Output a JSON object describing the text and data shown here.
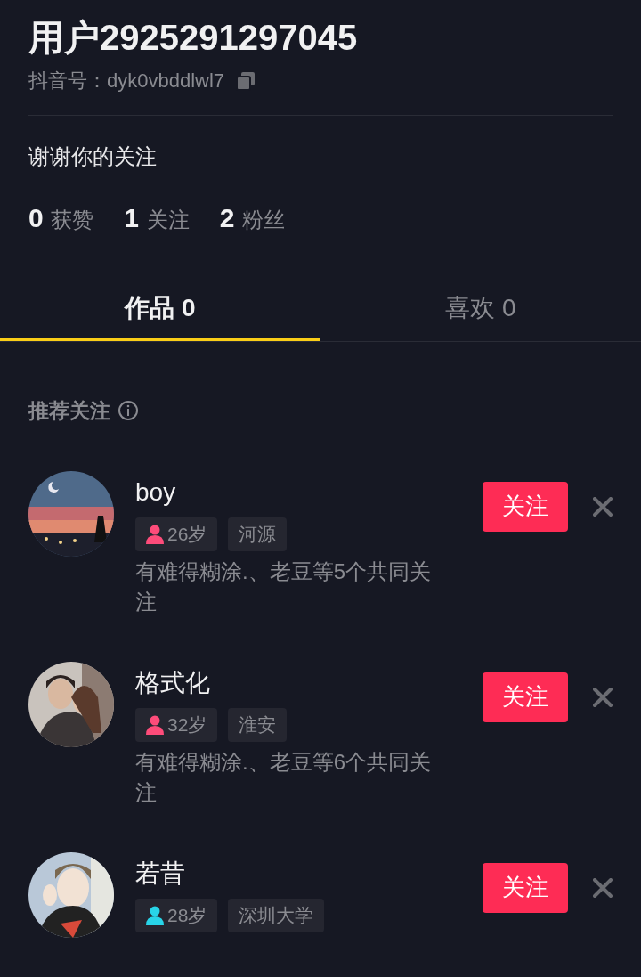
{
  "profile": {
    "name": "用户2925291297045",
    "id_label": "抖音号：dyk0vbddlwl7",
    "bio": "谢谢你的关注"
  },
  "stats": [
    "**0** 获赞",
    "**1** 关注",
    "**2** 粉丝"
  ],
  "tabs": [
    {
      "label": "作品 0",
      "selected": true
    },
    {
      "label": "喜欢 0",
      "selected": false
    }
  ],
  "recommend": {
    "title": "推荐关注",
    "users": [
      {
        "name": "boy",
        "kind": "female",
        "age": "26岁",
        "place": "河源",
        "mutual": "有难得糊涂.、老豆等5个共同关注",
        "button": "关注"
      },
      {
        "name": "格式化",
        "kind": "female",
        "age": "32岁",
        "place": "淮安",
        "mutual": "有难得糊涂.、老豆等6个共同关注",
        "button": "关注"
      },
      {
        "name": "若昔",
        "kind": "male",
        "age": "28岁",
        "place": "深圳大学",
        "button": "关注"
      }
    ]
  }
}
